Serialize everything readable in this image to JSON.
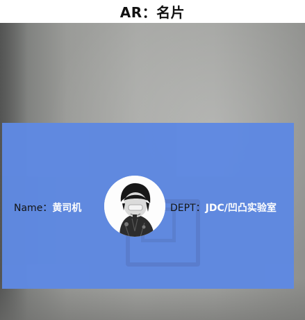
{
  "header": {
    "title": "AR：名片"
  },
  "card": {
    "name_key": "Name：",
    "name_value": "黄司机",
    "dept_key": "DEPT：",
    "dept_value": "JDC/凹凸实验室",
    "avatar_icon": "avatar-photo",
    "background_color": "#5f89e1"
  },
  "camera": {
    "icon": "camera-feed"
  }
}
